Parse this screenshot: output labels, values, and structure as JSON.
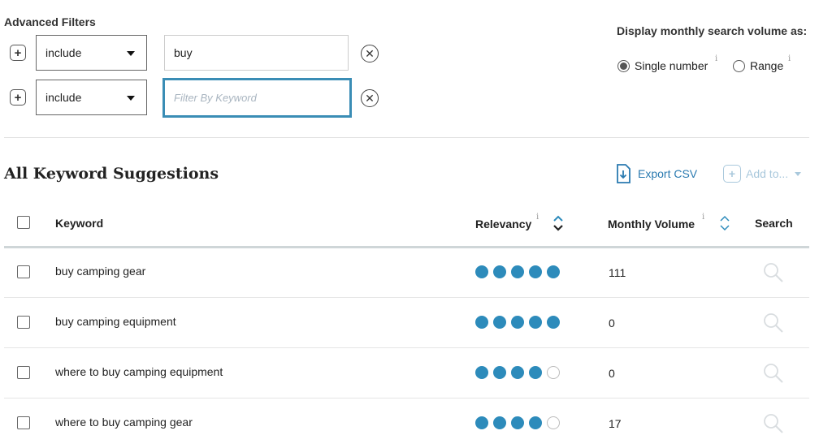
{
  "filters": {
    "title": "Advanced Filters",
    "rows": [
      {
        "mode": "include",
        "value": "buy",
        "placeholder": ""
      },
      {
        "mode": "include",
        "value": "",
        "placeholder": "Filter By Keyword"
      }
    ]
  },
  "display": {
    "label": "Display monthly search volume as:",
    "options": [
      {
        "label": "Single number",
        "checked": true
      },
      {
        "label": "Range",
        "checked": false
      }
    ],
    "info_glyph": "i"
  },
  "suggestions": {
    "title": "All Keyword Suggestions",
    "export_label": "Export CSV",
    "add_label": "Add to...",
    "columns": {
      "keyword": "Keyword",
      "relevancy": "Relevancy",
      "volume": "Monthly Volume",
      "search": "Search"
    },
    "rows": [
      {
        "keyword": "buy camping gear",
        "relevancy": 5,
        "volume": "111"
      },
      {
        "keyword": "buy camping equipment",
        "relevancy": 5,
        "volume": "0"
      },
      {
        "keyword": "where to buy camping equipment",
        "relevancy": 4,
        "volume": "0"
      },
      {
        "keyword": "where to buy camping gear",
        "relevancy": 4,
        "volume": "17"
      }
    ]
  },
  "colors": {
    "accent": "#2a7ab0",
    "dot_on": "#2d8bbb",
    "focus_border": "#3a8db5"
  },
  "icons": {
    "plus": "+",
    "clear": "✕"
  }
}
